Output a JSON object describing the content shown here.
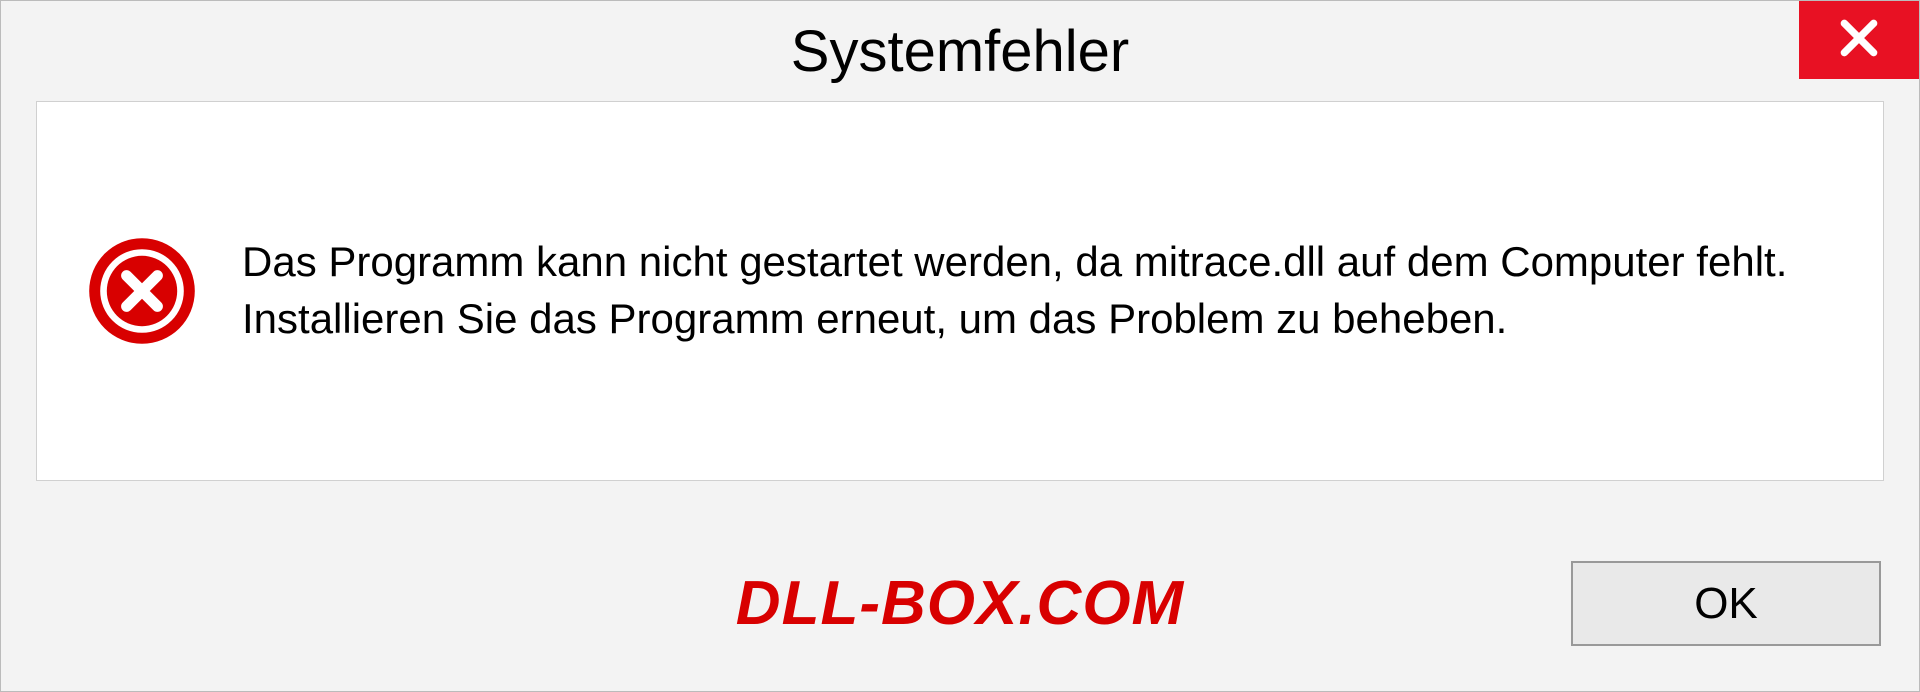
{
  "dialog": {
    "title": "Systemfehler",
    "message": "Das Programm kann nicht gestartet werden, da mitrace.dll auf dem Computer fehlt. Installieren Sie das Programm erneut, um das Problem zu beheben.",
    "ok_label": "OK"
  },
  "watermark": "DLL-BOX.COM"
}
